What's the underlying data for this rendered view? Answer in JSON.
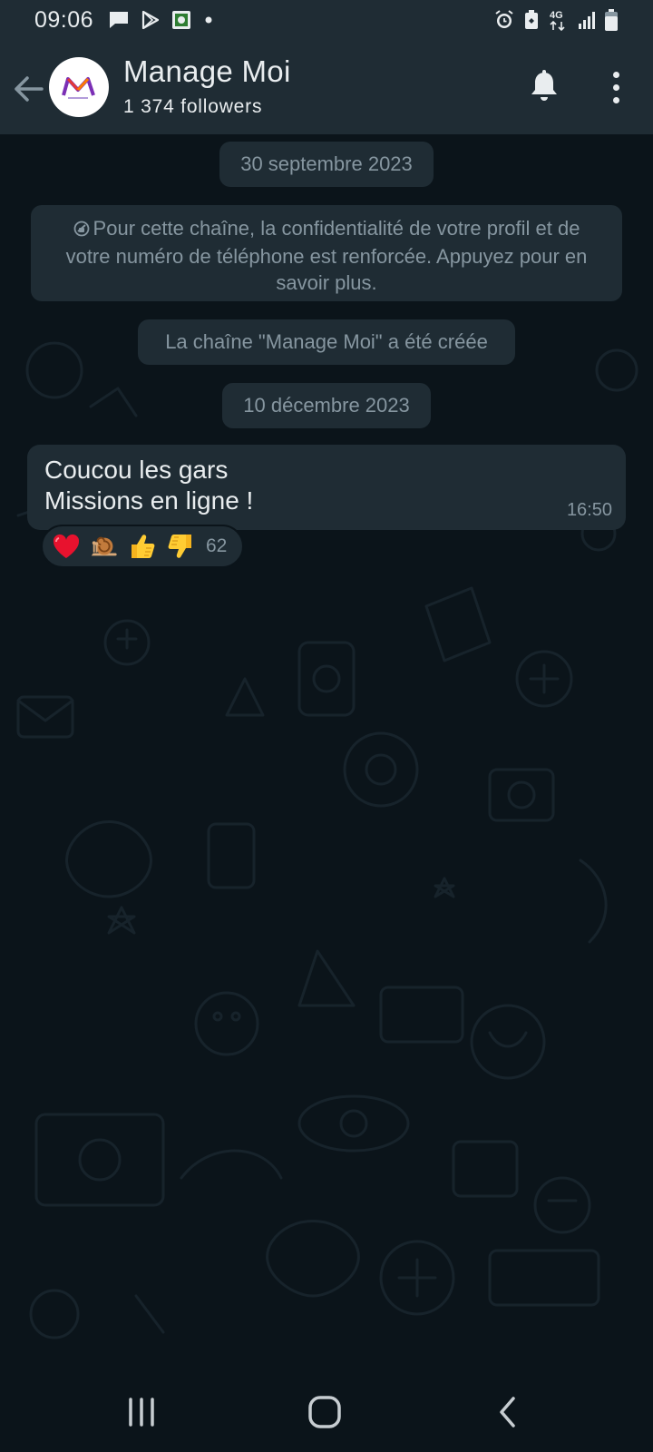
{
  "status_bar": {
    "time": "09:06",
    "left_icons": [
      "message-icon",
      "play-store-icon",
      "app-icon",
      "dot-icon"
    ],
    "right_icons": [
      "alarm-icon",
      "battery-saver-icon",
      "4g-signal-icon",
      "signal-bars-icon",
      "battery-icon"
    ],
    "network": "4G"
  },
  "header": {
    "channel_name": "Manage Moi",
    "followers": "1 374 followers"
  },
  "chat": {
    "date_1": "30 septembre 2023",
    "privacy_notice": "Pour cette chaîne, la confidentialité de votre profil et de votre numéro de téléphone est renforcée. Appuyez pour en savoir plus.",
    "channel_created": "La chaîne \"Manage Moi\" a été créée",
    "date_2": "10 décembre 2023",
    "message": {
      "line_1": "Coucou les gars",
      "line_2": "Missions en ligne !",
      "time": "16:50"
    },
    "reactions": {
      "emojis": [
        "heart",
        "snail",
        "thumbs-up",
        "thumbs-down"
      ],
      "count": "62"
    }
  },
  "colors": {
    "background": "#0b141a",
    "bar": "#1f2c34",
    "text": "#e9edef",
    "muted": "#8696a0"
  }
}
